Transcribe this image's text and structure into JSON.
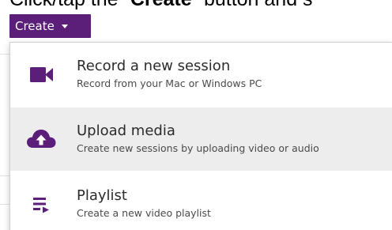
{
  "instruction": {
    "prefix": "Click/tap the “",
    "bold": "Create",
    "suffix": "” button and s"
  },
  "create_button": {
    "label": "Create"
  },
  "menu": {
    "items": [
      {
        "title": "Record a new session",
        "subtitle": "Record from your Mac or Windows PC",
        "icon": "video-camera-icon",
        "highlighted": false
      },
      {
        "title": "Upload media",
        "subtitle": "Create new sessions by uploading video or audio",
        "icon": "cloud-upload-icon",
        "highlighted": true
      },
      {
        "title": "Playlist",
        "subtitle": "Create a new video playlist",
        "icon": "playlist-icon",
        "highlighted": false
      }
    ]
  },
  "colors": {
    "brand_purple": "#5b1f7a",
    "highlight": "#ededed"
  }
}
